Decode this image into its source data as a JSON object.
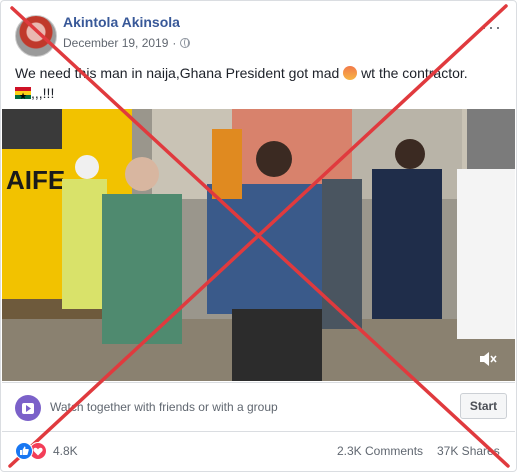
{
  "post": {
    "author": "Akintola Akinsola",
    "date": "December 19, 2019",
    "dot": "·",
    "more": "···",
    "text_line1": "We need this man in naija,Ghana President got mad",
    "text_line1_end": "wt the contractor.",
    "text_line2_end": ",,,!!!"
  },
  "video": {
    "sign_text": "AIFE"
  },
  "watch": {
    "label": "Watch together with friends or with a group",
    "start": "Start"
  },
  "footer": {
    "reaction_count": "4.8K",
    "comments": "2.3K Comments",
    "shares": "37K Shares"
  },
  "colors": {
    "author_link": "#385898",
    "x_overlay": "#e03a3e"
  }
}
